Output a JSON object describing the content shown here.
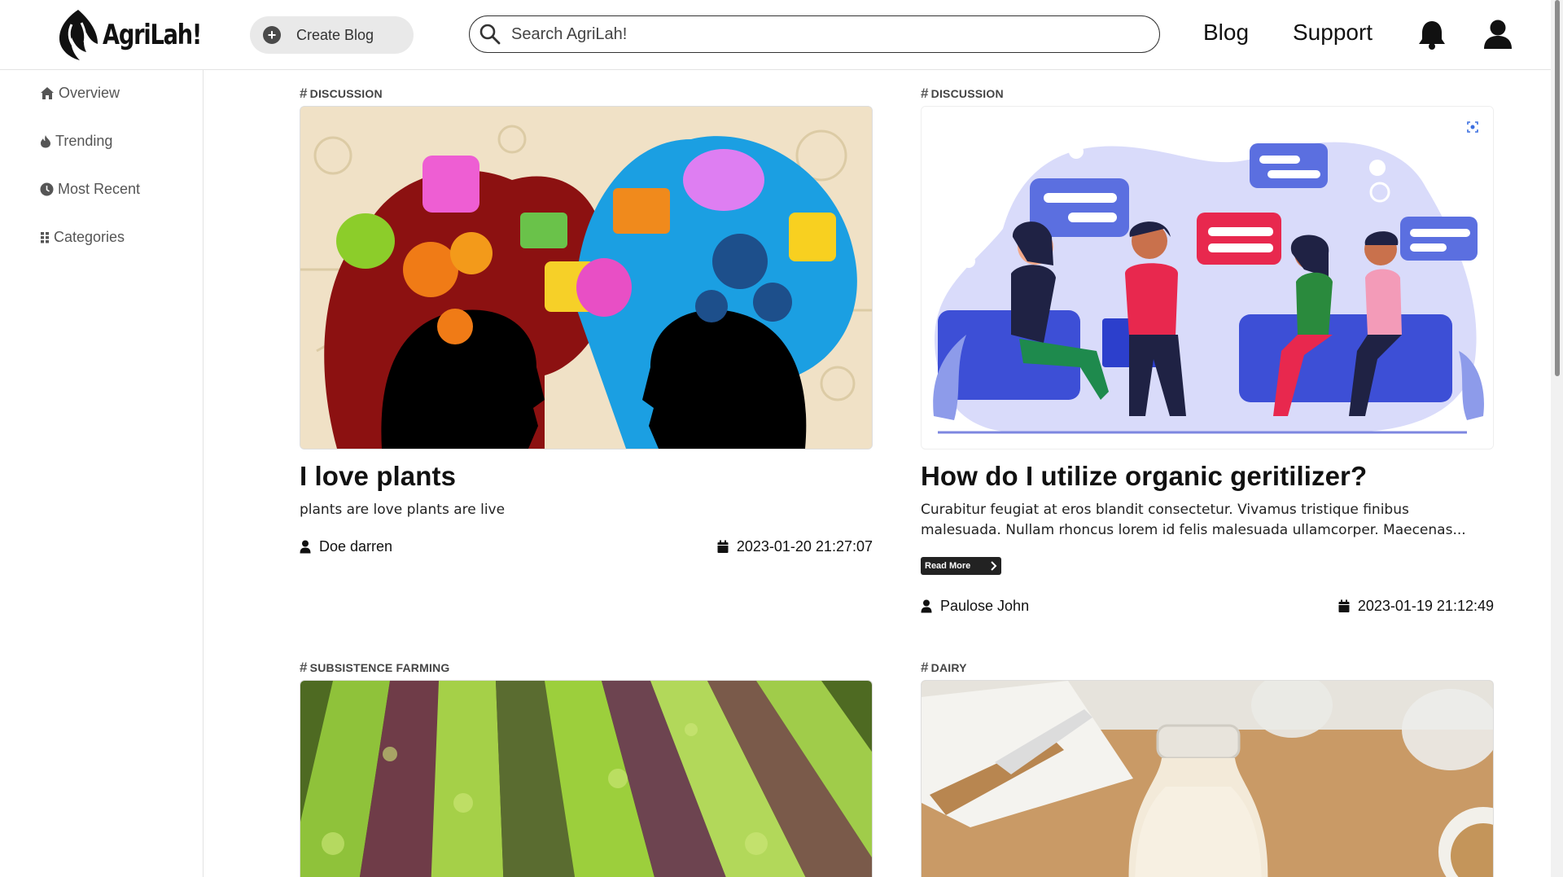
{
  "app": {
    "logo_text": "AgriLah!"
  },
  "header": {
    "create_label": "Create Blog",
    "search_placeholder": "Search AgriLah!",
    "nav": {
      "blog": "Blog",
      "support": "Support"
    }
  },
  "sidebar": {
    "items": [
      {
        "label": "Overview",
        "icon": "home-icon"
      },
      {
        "label": "Trending",
        "icon": "fire-icon"
      },
      {
        "label": "Most Recent",
        "icon": "clock-icon"
      },
      {
        "label": "Categories",
        "icon": "grid-icon"
      }
    ]
  },
  "posts": [
    {
      "tag": "DISCUSSION",
      "title": "I love plants",
      "description": "plants are love plants are live",
      "author": "Doe darren",
      "date": "2023-01-20 21:27:07"
    },
    {
      "tag": "DISCUSSION",
      "title": "How do I utilize organic geritilizer?",
      "description": "Curabitur feugiat at eros blandit consectetur. Vivamus tristique finibus malesuada. Nullam rhoncus lorem id felis malesuada ullamcorper. Maecenas...",
      "read_more": "Read More",
      "author": "Paulose John",
      "date": "2023-01-19 21:12:49"
    },
    {
      "tag": "SUBSISTENCE FARMING"
    },
    {
      "tag": "DAIRY"
    }
  ],
  "colors": {
    "accent_dark": "#222222",
    "sidebar_text": "#555555",
    "red_bubble": "#e8284e",
    "purple_blob": "#d9dbfa"
  }
}
